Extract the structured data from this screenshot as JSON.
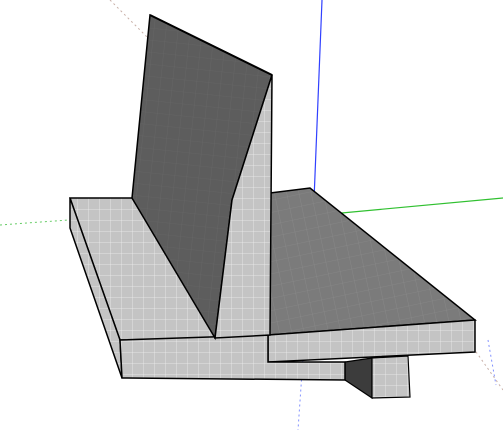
{
  "app": {
    "name": "",
    "tool": "orbit"
  },
  "viewport": {
    "background": "#ffffff",
    "axes": {
      "red": "#c8b0a8",
      "green": "#30c030",
      "blue": "#3040ff",
      "dotted_style": "dotted"
    },
    "model": {
      "description_visible": false,
      "face_light": "#c4c4c4",
      "face_top": "#7a7a7a",
      "face_shadow": "#5a5a5a",
      "face_dark": "#4a4a4a",
      "grid_line": "#ffffff",
      "edge": "#000000"
    }
  }
}
